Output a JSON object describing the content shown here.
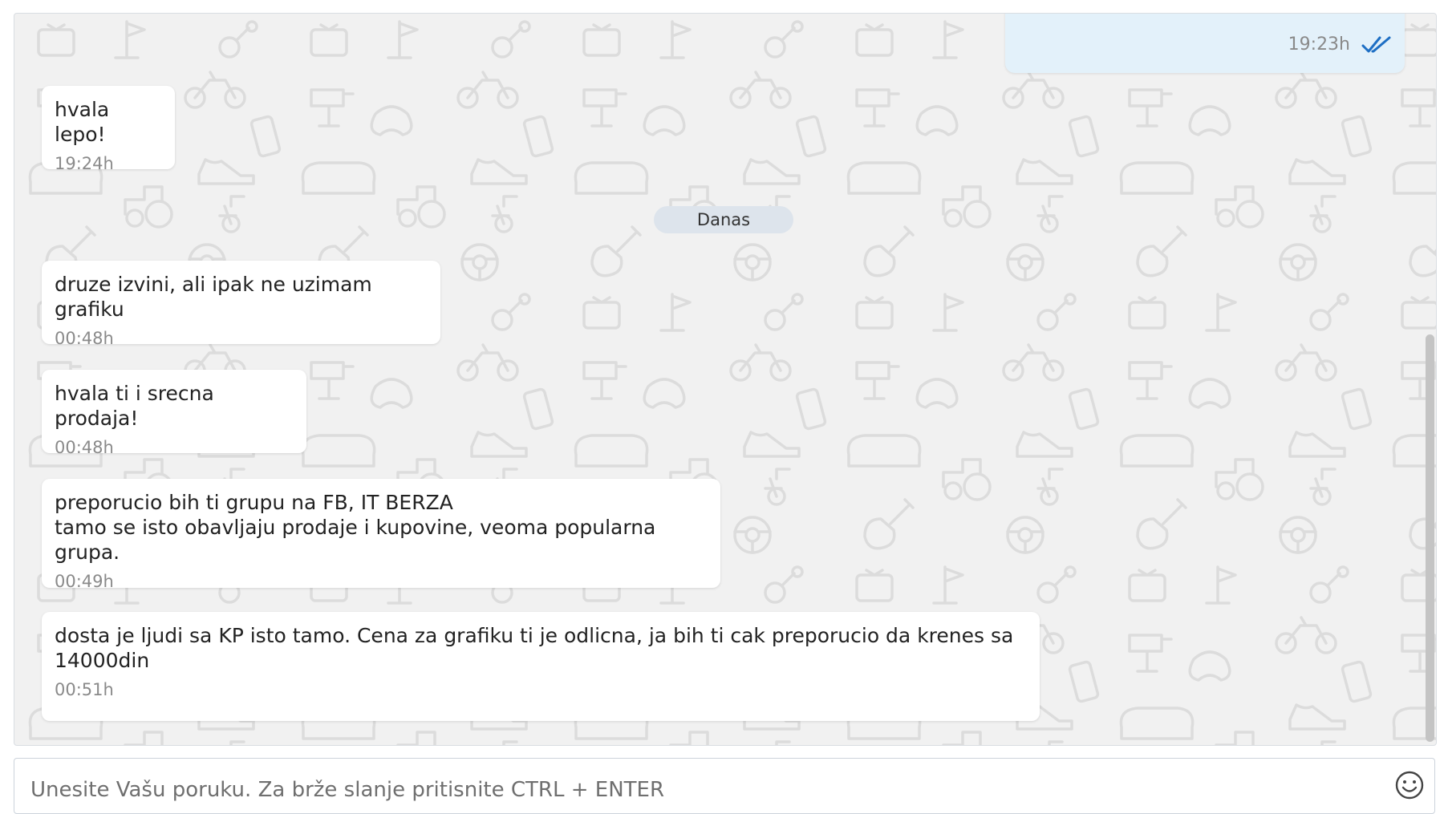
{
  "chat": {
    "sent_message": {
      "time": "19:23h"
    },
    "day_separator": "Danas",
    "messages": [
      {
        "text": "hvala lepo!",
        "time": "19:24h"
      },
      {
        "text": "druze izvini, ali ipak ne uzimam grafiku",
        "time": "00:48h"
      },
      {
        "text": "hvala ti i srecna prodaja!",
        "time": "00:48h"
      },
      {
        "text": "preporucio bih ti grupu na FB, IT BERZA\ntamo se isto obavljaju prodaje i kupovine, veoma popularna grupa.",
        "time": "00:49h"
      },
      {
        "text": "dosta je ljudi sa KP isto tamo. Cena za grafiku ti je odlicna, ja bih ti cak preporucio da krenes sa\n14000din",
        "time": "00:51h"
      }
    ]
  },
  "composer": {
    "placeholder": "Unesite Vašu poruku. Za brže slanje pritisnite CTRL + ENTER",
    "emoji_icon": "smiley-icon"
  },
  "colors": {
    "chat_background": "#f1f1f1",
    "sent_bubble": "#e3f1fa",
    "received_bubble": "#ffffff",
    "read_ticks": "#1e6fc4"
  }
}
